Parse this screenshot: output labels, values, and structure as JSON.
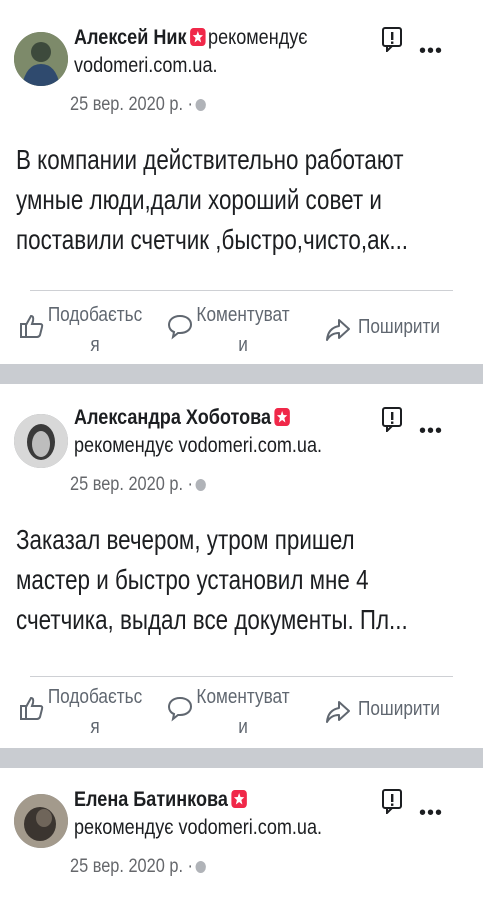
{
  "posts": [
    {
      "author": "Алексей Ник",
      "recommends_word": "рекомендує",
      "page": "vodomeri.com.ua.",
      "date": "25 вер. 2020 р. ·",
      "text_lines": [
        "В компании действительно работают",
        "умные люди,дали хороший совет и",
        "поставили счетчик ,быстро,чисто,ак..."
      ],
      "actions": {
        "like_l1": "Подобаєтьс",
        "like_l2": "я",
        "comment_l1": "Коментуват",
        "comment_l2": "и",
        "share": "Поширити"
      }
    },
    {
      "author": "Александра Хоботова",
      "recommends_word": "рекомендує",
      "page": "vodomeri.com.ua.",
      "date": "25 вер. 2020 р. ·",
      "text_lines": [
        "Заказал вечером, утром пришел",
        "мастер и быстро установил мне 4",
        "счетчика, выдал все документы. Пл..."
      ],
      "actions": {
        "like_l1": "Подобаєтьс",
        "like_l2": "я",
        "comment_l1": "Коментуват",
        "comment_l2": "и",
        "share": "Поширити"
      }
    },
    {
      "author": "Елена Батинкова",
      "recommends_word": "рекомендує",
      "page": "vodomeri.com.ua.",
      "date": "25 вер. 2020 р. ·"
    }
  ],
  "more_glyph": "•••",
  "colors": {
    "recommend_badge": "#f02849",
    "separator": "#c9ccd1",
    "muted_text": "#65676b"
  }
}
